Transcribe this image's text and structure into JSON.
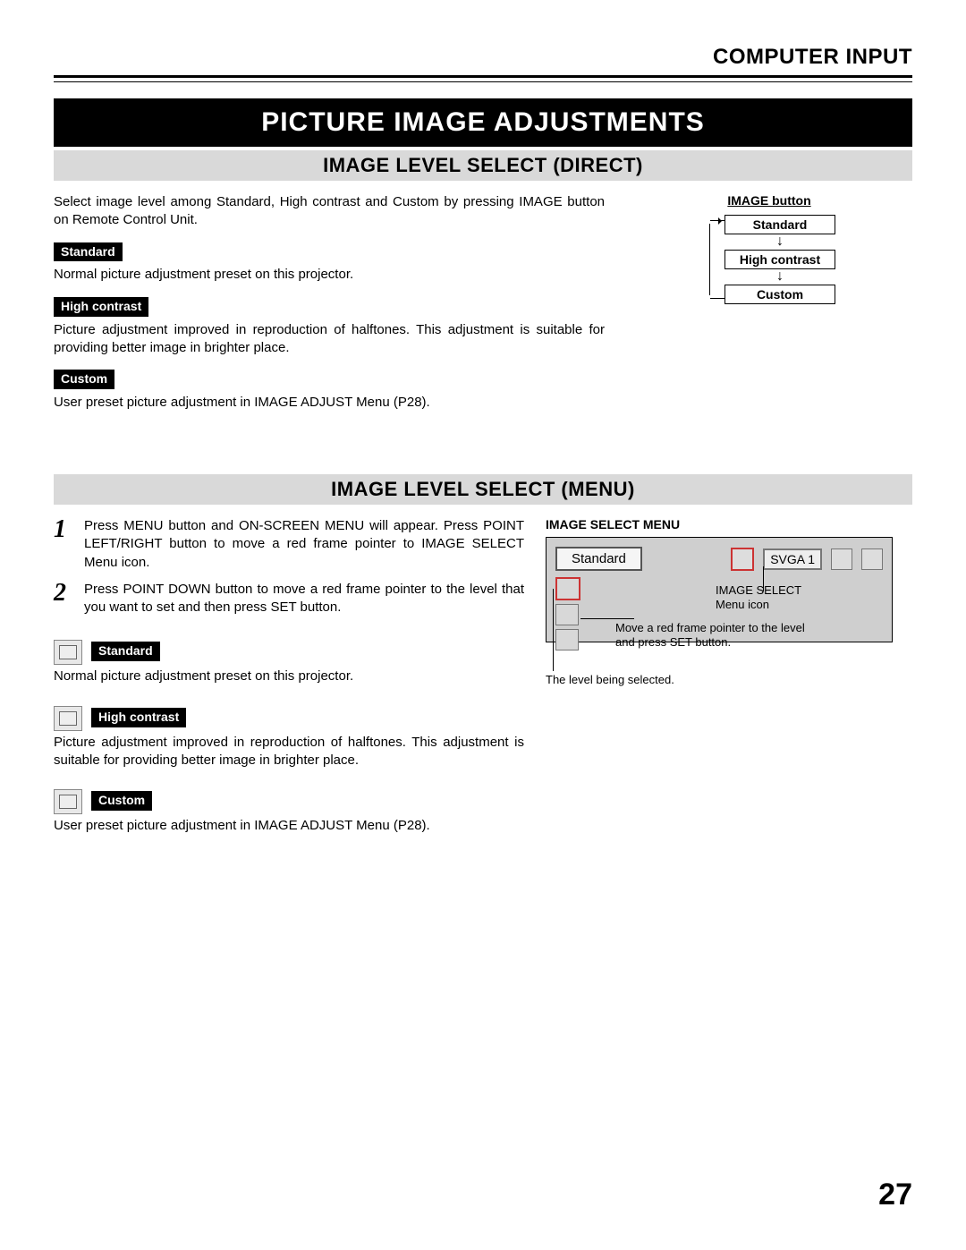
{
  "header": {
    "section": "COMPUTER INPUT"
  },
  "title": "PICTURE IMAGE ADJUSTMENTS",
  "sections": {
    "direct": {
      "heading": "IMAGE LEVEL SELECT (DIRECT)",
      "intro": "Select image level among Standard, High contrast and Custom by pressing IMAGE button on Remote Control Unit.",
      "levels": {
        "standard": {
          "tag": "Standard",
          "desc": "Normal picture adjustment preset on this projector."
        },
        "high_contrast": {
          "tag": "High contrast",
          "desc": "Picture adjustment improved in reproduction of halftones.  This adjustment is suitable for providing better image in brighter place."
        },
        "custom": {
          "tag": "Custom",
          "desc": "User preset picture adjustment in IMAGE ADJUST Menu (P28)."
        }
      },
      "flow": {
        "title": "IMAGE button",
        "items": [
          "Standard",
          "High contrast",
          "Custom"
        ]
      }
    },
    "menu": {
      "heading": "IMAGE LEVEL SELECT (MENU)",
      "steps": {
        "1": "Press MENU button and ON-SCREEN MENU will appear.  Press POINT LEFT/RIGHT button to move a red frame pointer to IMAGE SELECT Menu icon.",
        "2": "Press POINT DOWN button to move a red frame pointer to the level that you want to set and then press SET button."
      },
      "levels": {
        "standard": {
          "tag": "Standard",
          "desc": "Normal picture adjustment preset on this projector."
        },
        "high_contrast": {
          "tag": "High contrast",
          "desc": "Picture adjustment improved in reproduction of halftones.  This adjustment is suitable for providing better image in brighter place."
        },
        "custom": {
          "tag": "Custom",
          "desc": "User preset picture adjustment in IMAGE ADJUST Menu (P28)."
        }
      },
      "shot": {
        "title": "IMAGE SELECT MENU",
        "selected": "Standard",
        "mode": "SVGA 1",
        "callout_icon": "IMAGE SELECT Menu icon",
        "callout_row": "Move a red frame pointer to the level and press SET button.",
        "callout_sel": "The level being selected."
      }
    }
  },
  "page_number": "27"
}
